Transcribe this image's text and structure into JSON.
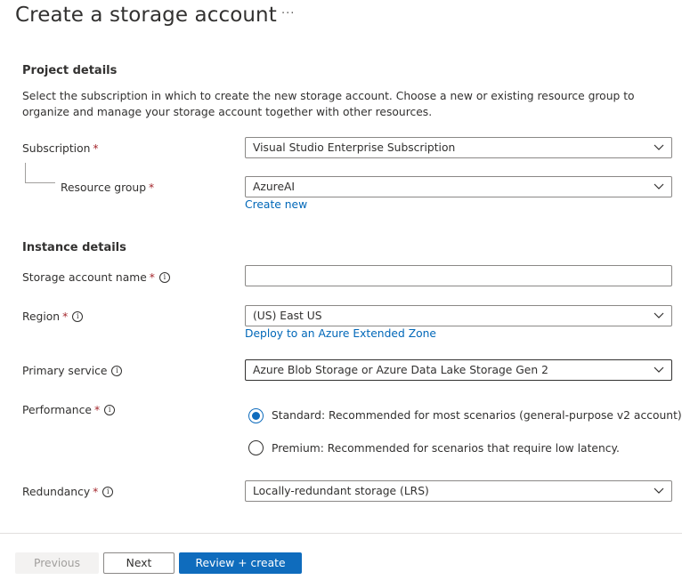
{
  "page": {
    "title": "Create a storage account",
    "more_icon": "···"
  },
  "project": {
    "heading": "Project details",
    "description": "Select the subscription in which to create the new storage account. Choose a new or existing resource group to organize and manage your storage account together with other resources.",
    "subscription": {
      "label": "Subscription",
      "required": "*",
      "value": "Visual Studio Enterprise Subscription"
    },
    "resource_group": {
      "label": "Resource group",
      "required": "*",
      "value": "AzureAI",
      "create_new": "Create new"
    }
  },
  "instance": {
    "heading": "Instance details",
    "account_name": {
      "label": "Storage account name",
      "required": "*",
      "value": ""
    },
    "region": {
      "label": "Region",
      "required": "*",
      "value": "(US) East US",
      "extended_zone": "Deploy to an Azure Extended Zone"
    },
    "primary_service": {
      "label": "Primary service",
      "value": "Azure Blob Storage or Azure Data Lake Storage Gen 2"
    },
    "performance": {
      "label": "Performance",
      "required": "*",
      "options": [
        {
          "label": "Standard: Recommended for most scenarios (general-purpose v2 account)",
          "checked": true
        },
        {
          "label": "Premium: Recommended for scenarios that require low latency.",
          "checked": false
        }
      ]
    },
    "redundancy": {
      "label": "Redundancy",
      "required": "*",
      "value": "Locally-redundant storage (LRS)"
    }
  },
  "footer": {
    "previous": "Previous",
    "next": "Next",
    "review": "Review + create"
  },
  "colors": {
    "accent": "#0f6cbd",
    "link": "#0067b8",
    "required": "#a4262c"
  }
}
